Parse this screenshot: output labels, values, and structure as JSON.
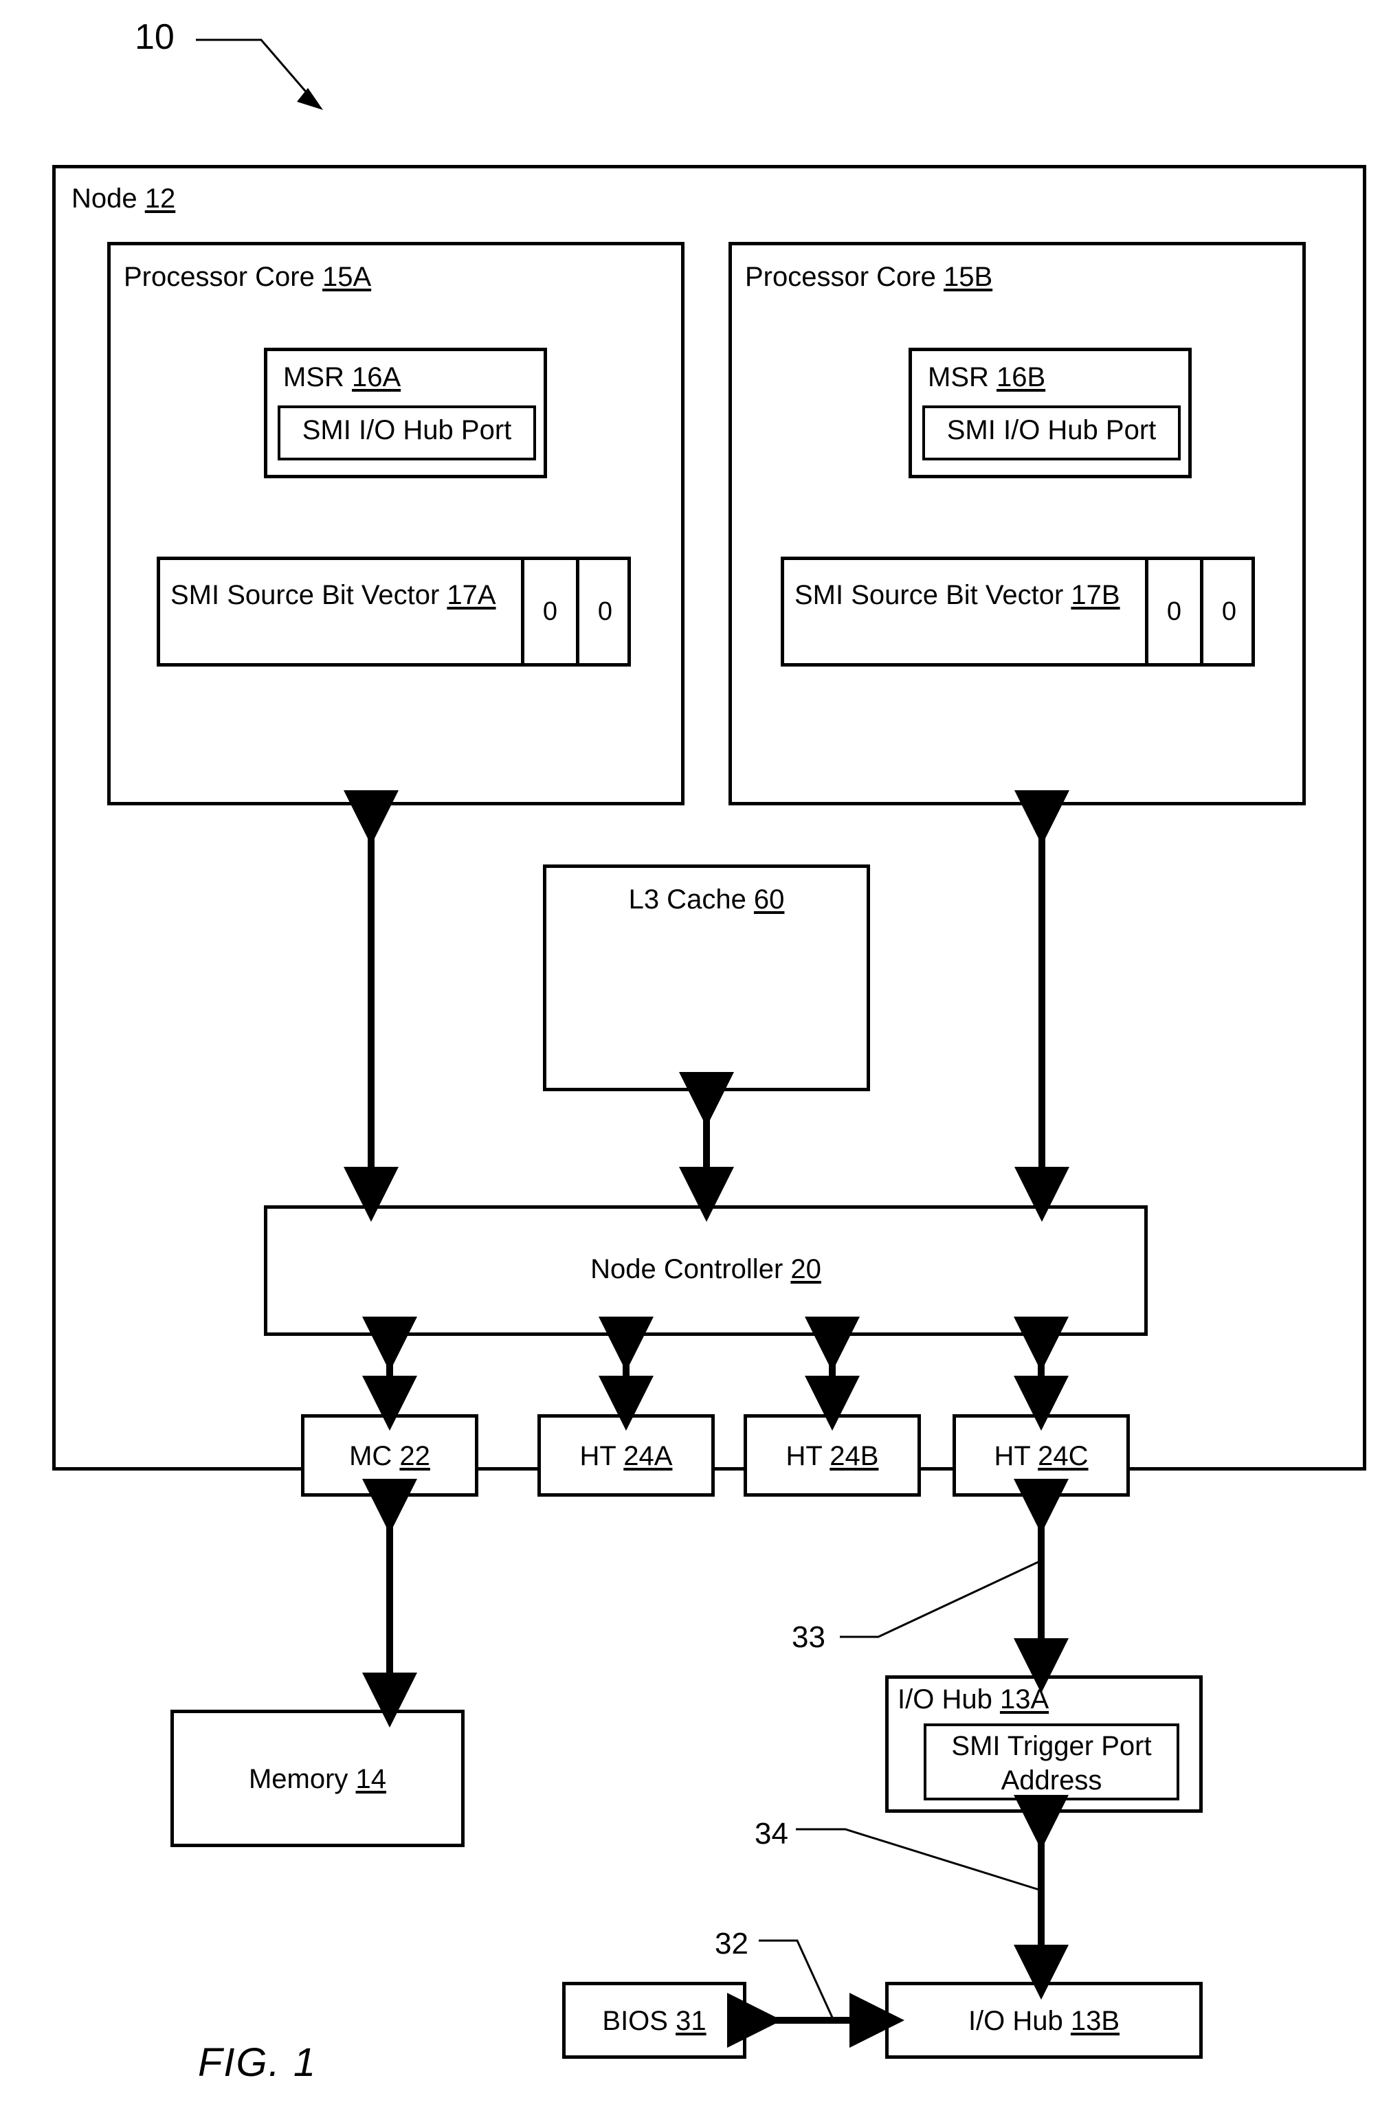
{
  "figure": {
    "caption": "FIG. 1",
    "system_ref": "10"
  },
  "node": {
    "title_text": "Node ",
    "title_ref": "12"
  },
  "cores": [
    {
      "title_text": "Processor Core ",
      "title_ref": "15A",
      "msr": {
        "title_text": "MSR ",
        "title_ref": "16A",
        "inner_label": "SMI I/O Hub Port"
      },
      "bit_vector": {
        "title_text": "SMI Source Bit Vector ",
        "title_ref": "17A",
        "cells": [
          "0",
          "0"
        ]
      }
    },
    {
      "title_text": "Processor Core ",
      "title_ref": "15B",
      "msr": {
        "title_text": "MSR ",
        "title_ref": "16B",
        "inner_label": "SMI I/O Hub Port"
      },
      "bit_vector": {
        "title_text": "SMI Source Bit Vector ",
        "title_ref": "17B",
        "cells": [
          "0",
          "0"
        ]
      }
    }
  ],
  "l3_cache": {
    "title_text": "L3 Cache ",
    "title_ref": "60"
  },
  "node_controller": {
    "title_text": "Node Controller ",
    "title_ref": "20"
  },
  "interfaces": [
    {
      "title_text": "MC ",
      "title_ref": "22"
    },
    {
      "title_text": "HT ",
      "title_ref": "24A"
    },
    {
      "title_text": "HT ",
      "title_ref": "24B"
    },
    {
      "title_text": "HT ",
      "title_ref": "24C"
    }
  ],
  "memory": {
    "title_text": "Memory ",
    "title_ref": "14"
  },
  "io_hub_a": {
    "title_text": "I/O Hub ",
    "title_ref": "13A",
    "inner_label_line1": "SMI Trigger Port",
    "inner_label_line2": "Address"
  },
  "io_hub_b": {
    "title_text": "I/O Hub ",
    "title_ref": "13B"
  },
  "bios": {
    "title_text": "BIOS ",
    "title_ref": "31"
  },
  "link_refs": {
    "ht_to_iohub_a": "33",
    "iohub_a_to_iohub_b": "34",
    "bios_to_iohub_b": "32"
  },
  "colors": {
    "line": "#000000",
    "background": "#ffffff"
  }
}
